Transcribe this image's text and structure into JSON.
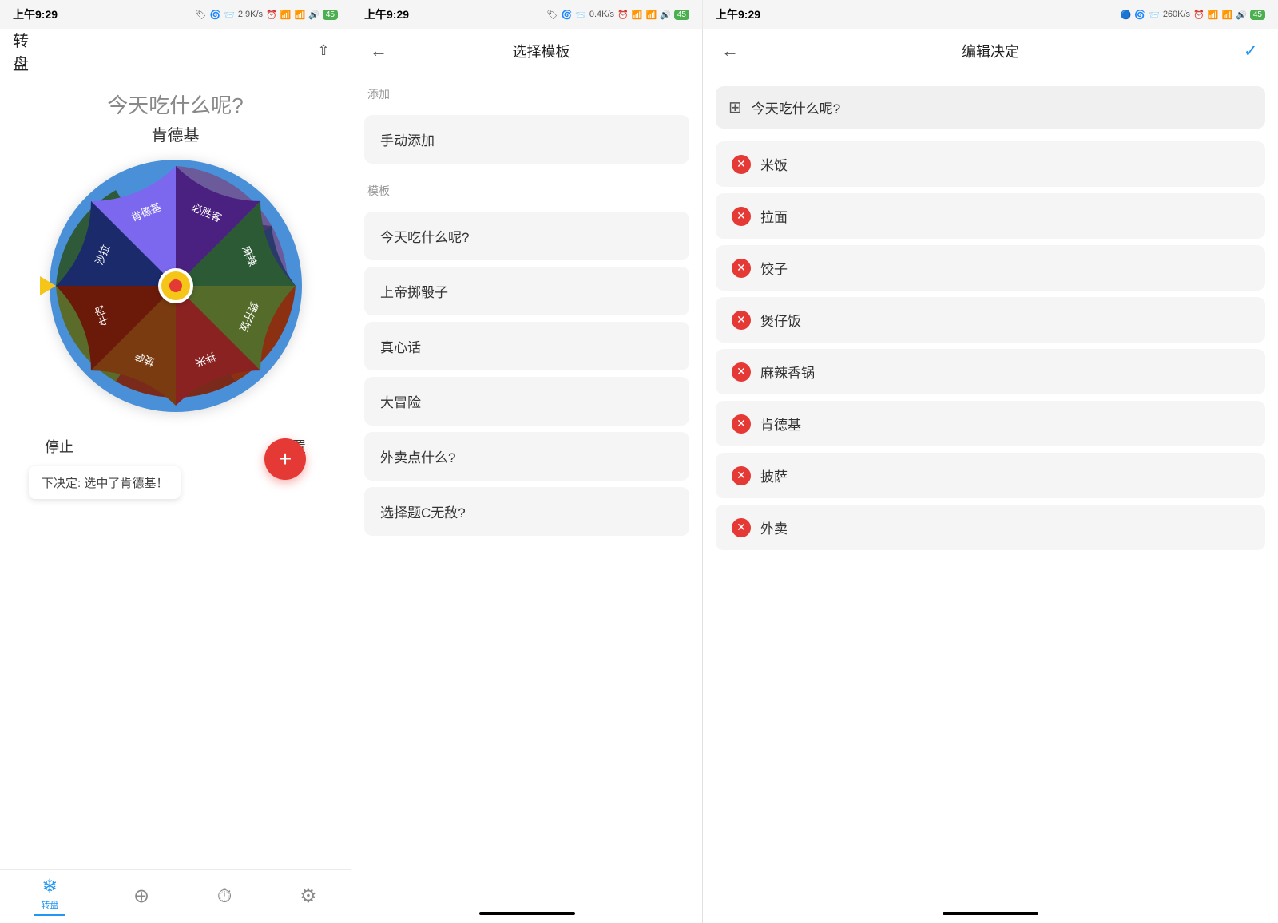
{
  "panels": [
    {
      "id": "spinner",
      "statusBar": {
        "time": "上午9:29",
        "speed": "2.9K/s",
        "signal": "信号图标"
      },
      "header": {
        "title": "转盘",
        "shareIcon": "↑"
      },
      "wheel": {
        "question": "今天吃什么呢?",
        "result": "肯德基",
        "segments": [
          {
            "label": "必胜客",
            "color": "#7B68EE",
            "startAngle": 0,
            "endAngle": 60
          },
          {
            "label": "麻辣香锅",
            "color": "#3D7A4E",
            "startAngle": 60,
            "endAngle": 120
          },
          {
            "label": "煲仔饭",
            "color": "#6B8E3E",
            "startAngle": 120,
            "endAngle": 180
          },
          {
            "label": "拌米",
            "color": "#8B3A2A",
            "startAngle": 180,
            "endAngle": 240
          },
          {
            "label": "披萨",
            "color": "#6B2A1A",
            "startAngle": 240,
            "endAngle": 290
          },
          {
            "label": "牛肉",
            "color": "#8B4513",
            "startAngle": 290,
            "endAngle": 340
          },
          {
            "label": "沙拉",
            "color": "#4169E1",
            "startAngle": 340,
            "endAngle": 360
          }
        ]
      },
      "buttons": {
        "stop": "停止",
        "reset": "重置"
      },
      "decisionPopup": "下决定: 选中了肯德基！",
      "bottomNav": [
        {
          "icon": "❄",
          "label": "转盘",
          "active": true
        },
        {
          "icon": "➕",
          "label": "",
          "active": false
        },
        {
          "icon": "🕐",
          "label": "",
          "active": false
        },
        {
          "icon": "⚙",
          "label": "",
          "active": false
        }
      ]
    },
    {
      "id": "template",
      "statusBar": {
        "time": "上午9:29",
        "speed": "0.4K/s"
      },
      "header": {
        "backIcon": "←",
        "title": "选择模板"
      },
      "sections": {
        "addLabel": "添加",
        "templateLabel": "模板"
      },
      "addItem": "手动添加",
      "templates": [
        "今天吃什么呢?",
        "上帝掷骰子",
        "真心话",
        "大冒险",
        "外卖点什么?",
        "选择题C无敌?"
      ]
    },
    {
      "id": "editDecision",
      "statusBar": {
        "time": "上午9:29",
        "speed": "260K/s"
      },
      "header": {
        "backIcon": "←",
        "title": "编辑决定",
        "checkIcon": "✓"
      },
      "listTitle": "今天吃什么呢?",
      "items": [
        "米饭",
        "拉面",
        "饺子",
        "煲仔饭",
        "麻辣香锅",
        "肯德基",
        "披萨",
        "外卖"
      ]
    }
  ]
}
